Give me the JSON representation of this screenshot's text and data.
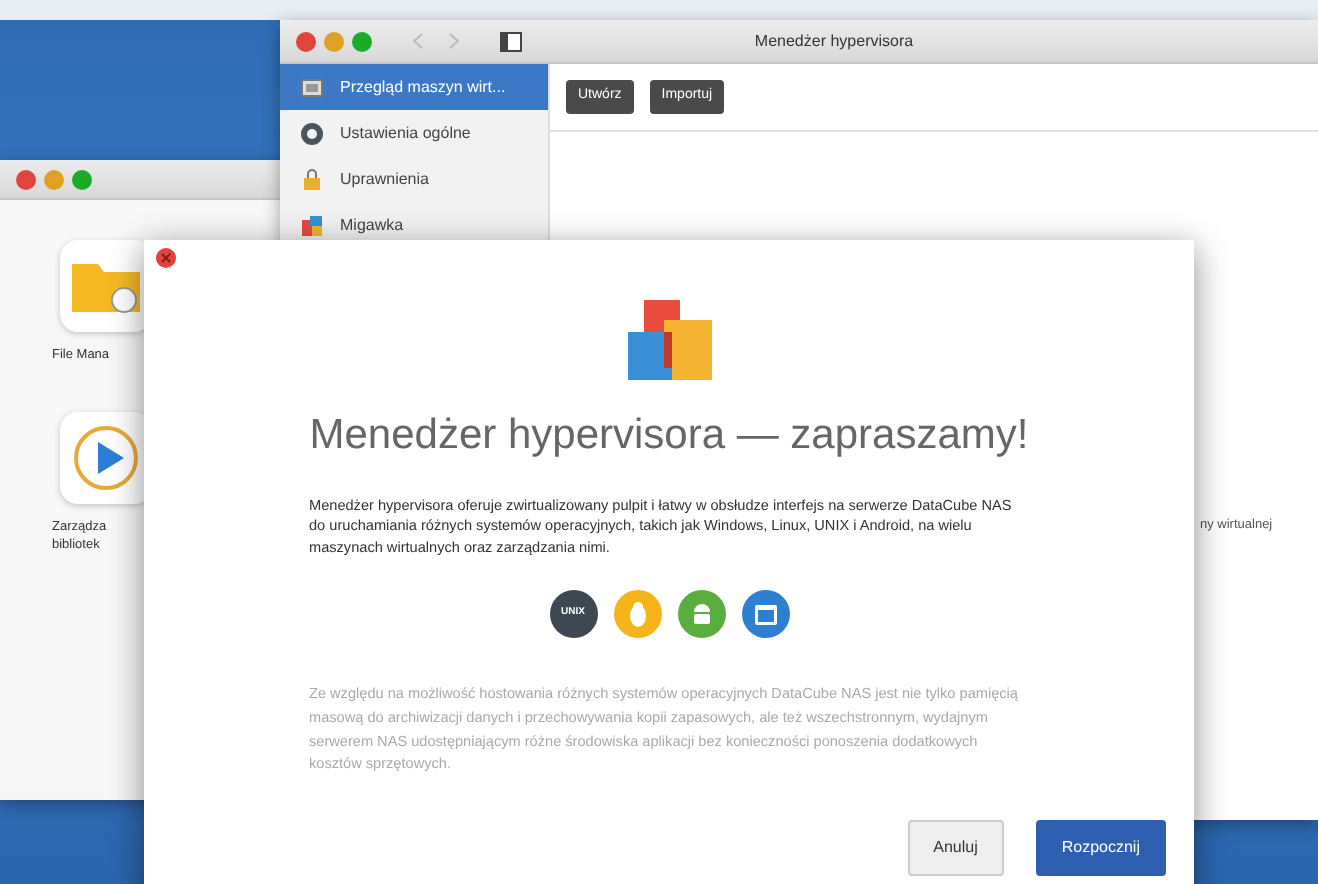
{
  "file_window": {
    "apps": [
      {
        "kind": "folder",
        "lines": [
          "File Mana"
        ]
      },
      {
        "kind": "player",
        "lines": [
          "Zarządza",
          "bibliotek"
        ]
      }
    ]
  },
  "hypervisor_window": {
    "title": "Menedżer hypervisora",
    "sidebar": [
      {
        "label": "Przegląd maszyn wirt...",
        "kind": "vm",
        "selected": true
      },
      {
        "label": "Ustawienia ogólne",
        "kind": "settings",
        "selected": false
      },
      {
        "label": "Uprawnienia",
        "kind": "permissions",
        "selected": false
      },
      {
        "label": "Migawka",
        "kind": "snapshot",
        "selected": false
      }
    ],
    "toolbar": [
      "Utwórz",
      "Importuj"
    ],
    "content_text": "ny wirtualnej"
  },
  "dialog": {
    "heading": "Menedżer hypervisora — zapraszamy!",
    "intro": "Menedżer hypervisora oferuje zwirtualizowany pulpit i łatwy w obsłudze interfejs na serwerze DataCube NAS do uruchamiania różnych systemów operacyjnych, takich jak Windows, Linux, UNIX i Android, na wielu maszynach wirtualnych oraz zarządzania nimi.",
    "os": [
      {
        "kind": "unix",
        "label": "UNIX"
      },
      {
        "kind": "linux"
      },
      {
        "kind": "android"
      },
      {
        "kind": "windows"
      }
    ],
    "note": "Ze względu na możliwość hostowania różnych systemów operacyjnych DataCube NAS jest nie tylko pamięcią masową do archiwizacji danych i przechowywania kopii zapasowych, ale też wszechstronnym, wydajnym serwerem NAS udostępniającym różne środowiska aplikacji bez konieczności ponoszenia dodatkowych kosztów sprzętowych.",
    "buttons": [
      {
        "label": "Anuluj",
        "kind": "secondary"
      },
      {
        "label": "Rozpocznij",
        "kind": "primary"
      }
    ]
  }
}
